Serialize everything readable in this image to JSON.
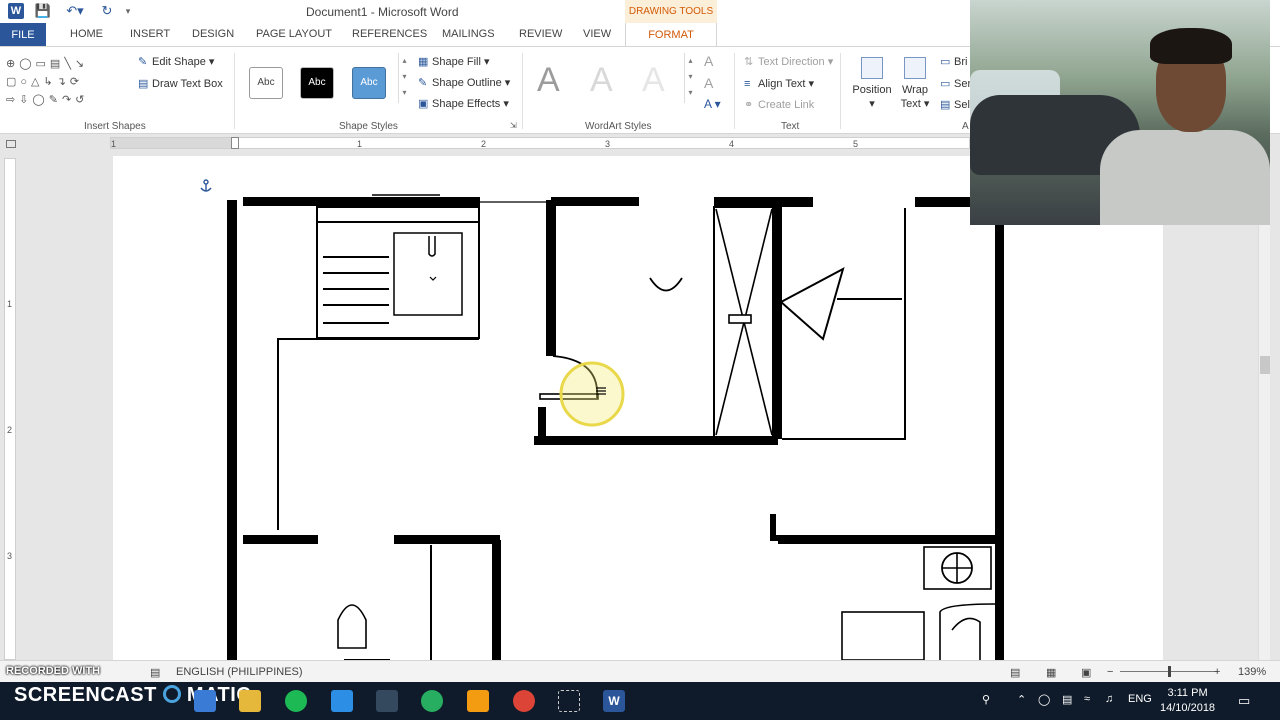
{
  "window": {
    "title": "Document1 - Microsoft Word",
    "contextual_tab_group": "DRAWING TOOLS",
    "app_icon": "W"
  },
  "quick_access": {
    "save_icon": "save-icon",
    "undo_icon": "undo-icon",
    "redo_icon": "redo-icon",
    "customize_icon": "customize-icon"
  },
  "tabs": [
    "FILE",
    "HOME",
    "INSERT",
    "DESIGN",
    "PAGE LAYOUT",
    "REFERENCES",
    "MAILINGS",
    "REVIEW",
    "VIEW",
    "FORMAT"
  ],
  "ribbon": {
    "insert_shapes": {
      "label": "Insert Shapes",
      "edit_shape": "Edit Shape",
      "draw_text_box": "Draw Text Box"
    },
    "shape_styles": {
      "label": "Shape Styles",
      "presets": [
        "Abc",
        "Abc",
        "Abc"
      ],
      "preset_colors": [
        "#ffffff",
        "#000000",
        "#5b9bd5"
      ],
      "shape_fill": "Shape Fill",
      "shape_outline": "Shape Outline",
      "shape_effects": "Shape Effects"
    },
    "wordart_styles": {
      "label": "WordArt Styles",
      "letters": [
        "A",
        "A",
        "A"
      ]
    },
    "text": {
      "label": "Text",
      "text_direction": "Text Direction",
      "align_text": "Align Text",
      "create_link": "Create Link"
    },
    "arrange": {
      "position": "Position",
      "wrap_text_1": "Wrap",
      "wrap_text_2": "Text",
      "bring": "Bri",
      "send": "Sen",
      "selection": "Sel",
      "group_label": "A"
    }
  },
  "ruler": {
    "numbers": [
      "1",
      "1",
      "2",
      "3",
      "4",
      "5"
    ],
    "vertical_numbers": [
      "1",
      "2",
      "3"
    ]
  },
  "status_bar": {
    "language": "ENGLISH (PHILIPPINES)",
    "zoom": "139%"
  },
  "overlay": {
    "recorded_with": "RECORDED WITH",
    "screencast_a": "SCREENCAST",
    "screencast_b": "MATIC"
  },
  "taskbar": {
    "time": "3:11 PM",
    "date": "14/10/2018",
    "lang": "ENG"
  },
  "colors": {
    "word_blue": "#2b579a",
    "drawing_tools_orange": "#d35a07",
    "cursor_highlight": "#f2e25a"
  }
}
